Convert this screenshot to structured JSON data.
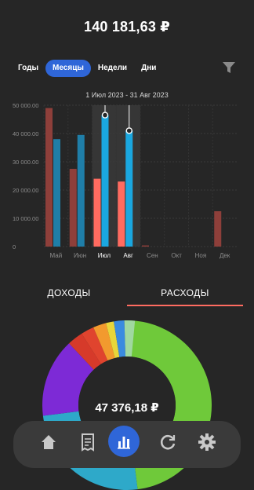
{
  "header": {
    "total": "140 181,63 ₽"
  },
  "period_tabs": [
    {
      "label": "Годы",
      "active": false
    },
    {
      "label": "Месяцы",
      "active": true
    },
    {
      "label": "Недели",
      "active": false
    },
    {
      "label": "Дни",
      "active": false
    }
  ],
  "filter_icon": "filter-icon",
  "date_range": "1 Июл 2023 - 31 Авг 2023",
  "chart_data": {
    "type": "bar",
    "categories": [
      "Май",
      "Июн",
      "Июл",
      "Авг",
      "Сен",
      "Окт",
      "Ноя",
      "Дек"
    ],
    "y_ticks": [
      "50 000.00",
      "40 000.00",
      "30 000.00",
      "20 000.00",
      "10 000.00",
      "0"
    ],
    "ylim": [
      0,
      50000
    ],
    "series": [
      {
        "color": "#ff6b60",
        "values": [
          49000,
          27500,
          24000,
          23000,
          400,
          0,
          0,
          12500
        ]
      },
      {
        "color": "#1aa7e0",
        "values": [
          38000,
          39500,
          46500,
          41000,
          0,
          0,
          0,
          0
        ]
      }
    ],
    "selected": [
      "Июл",
      "Авг"
    ],
    "grid": true
  },
  "type_tabs": [
    {
      "label": "ДОХОДЫ",
      "active": false
    },
    {
      "label": "РАСХОДЫ",
      "active": true
    }
  ],
  "accent_color": "#ff6b60",
  "donut": {
    "center_label": "47 376,18 ₽",
    "segments": [
      {
        "color": "#6fc93a",
        "fraction": 0.48
      },
      {
        "color": "#2ea9c9",
        "fraction": 0.25
      },
      {
        "color": "#7d2ad6",
        "fraction": 0.15
      },
      {
        "color": "#d63a2a",
        "fraction": 0.03
      },
      {
        "color": "#e0442e",
        "fraction": 0.025
      },
      {
        "color": "#f29a2e",
        "fraction": 0.025
      },
      {
        "color": "#e8d63a",
        "fraction": 0.015
      },
      {
        "color": "#3a8be0",
        "fraction": 0.02
      },
      {
        "color": "#a0d8a0",
        "fraction": 0.02
      }
    ]
  },
  "bottom_nav": [
    {
      "icon": "home-icon",
      "active": false
    },
    {
      "icon": "receipt-icon",
      "active": false
    },
    {
      "icon": "chart-icon",
      "active": true
    },
    {
      "icon": "refresh-icon",
      "active": false
    },
    {
      "icon": "settings-icon",
      "active": false
    }
  ]
}
